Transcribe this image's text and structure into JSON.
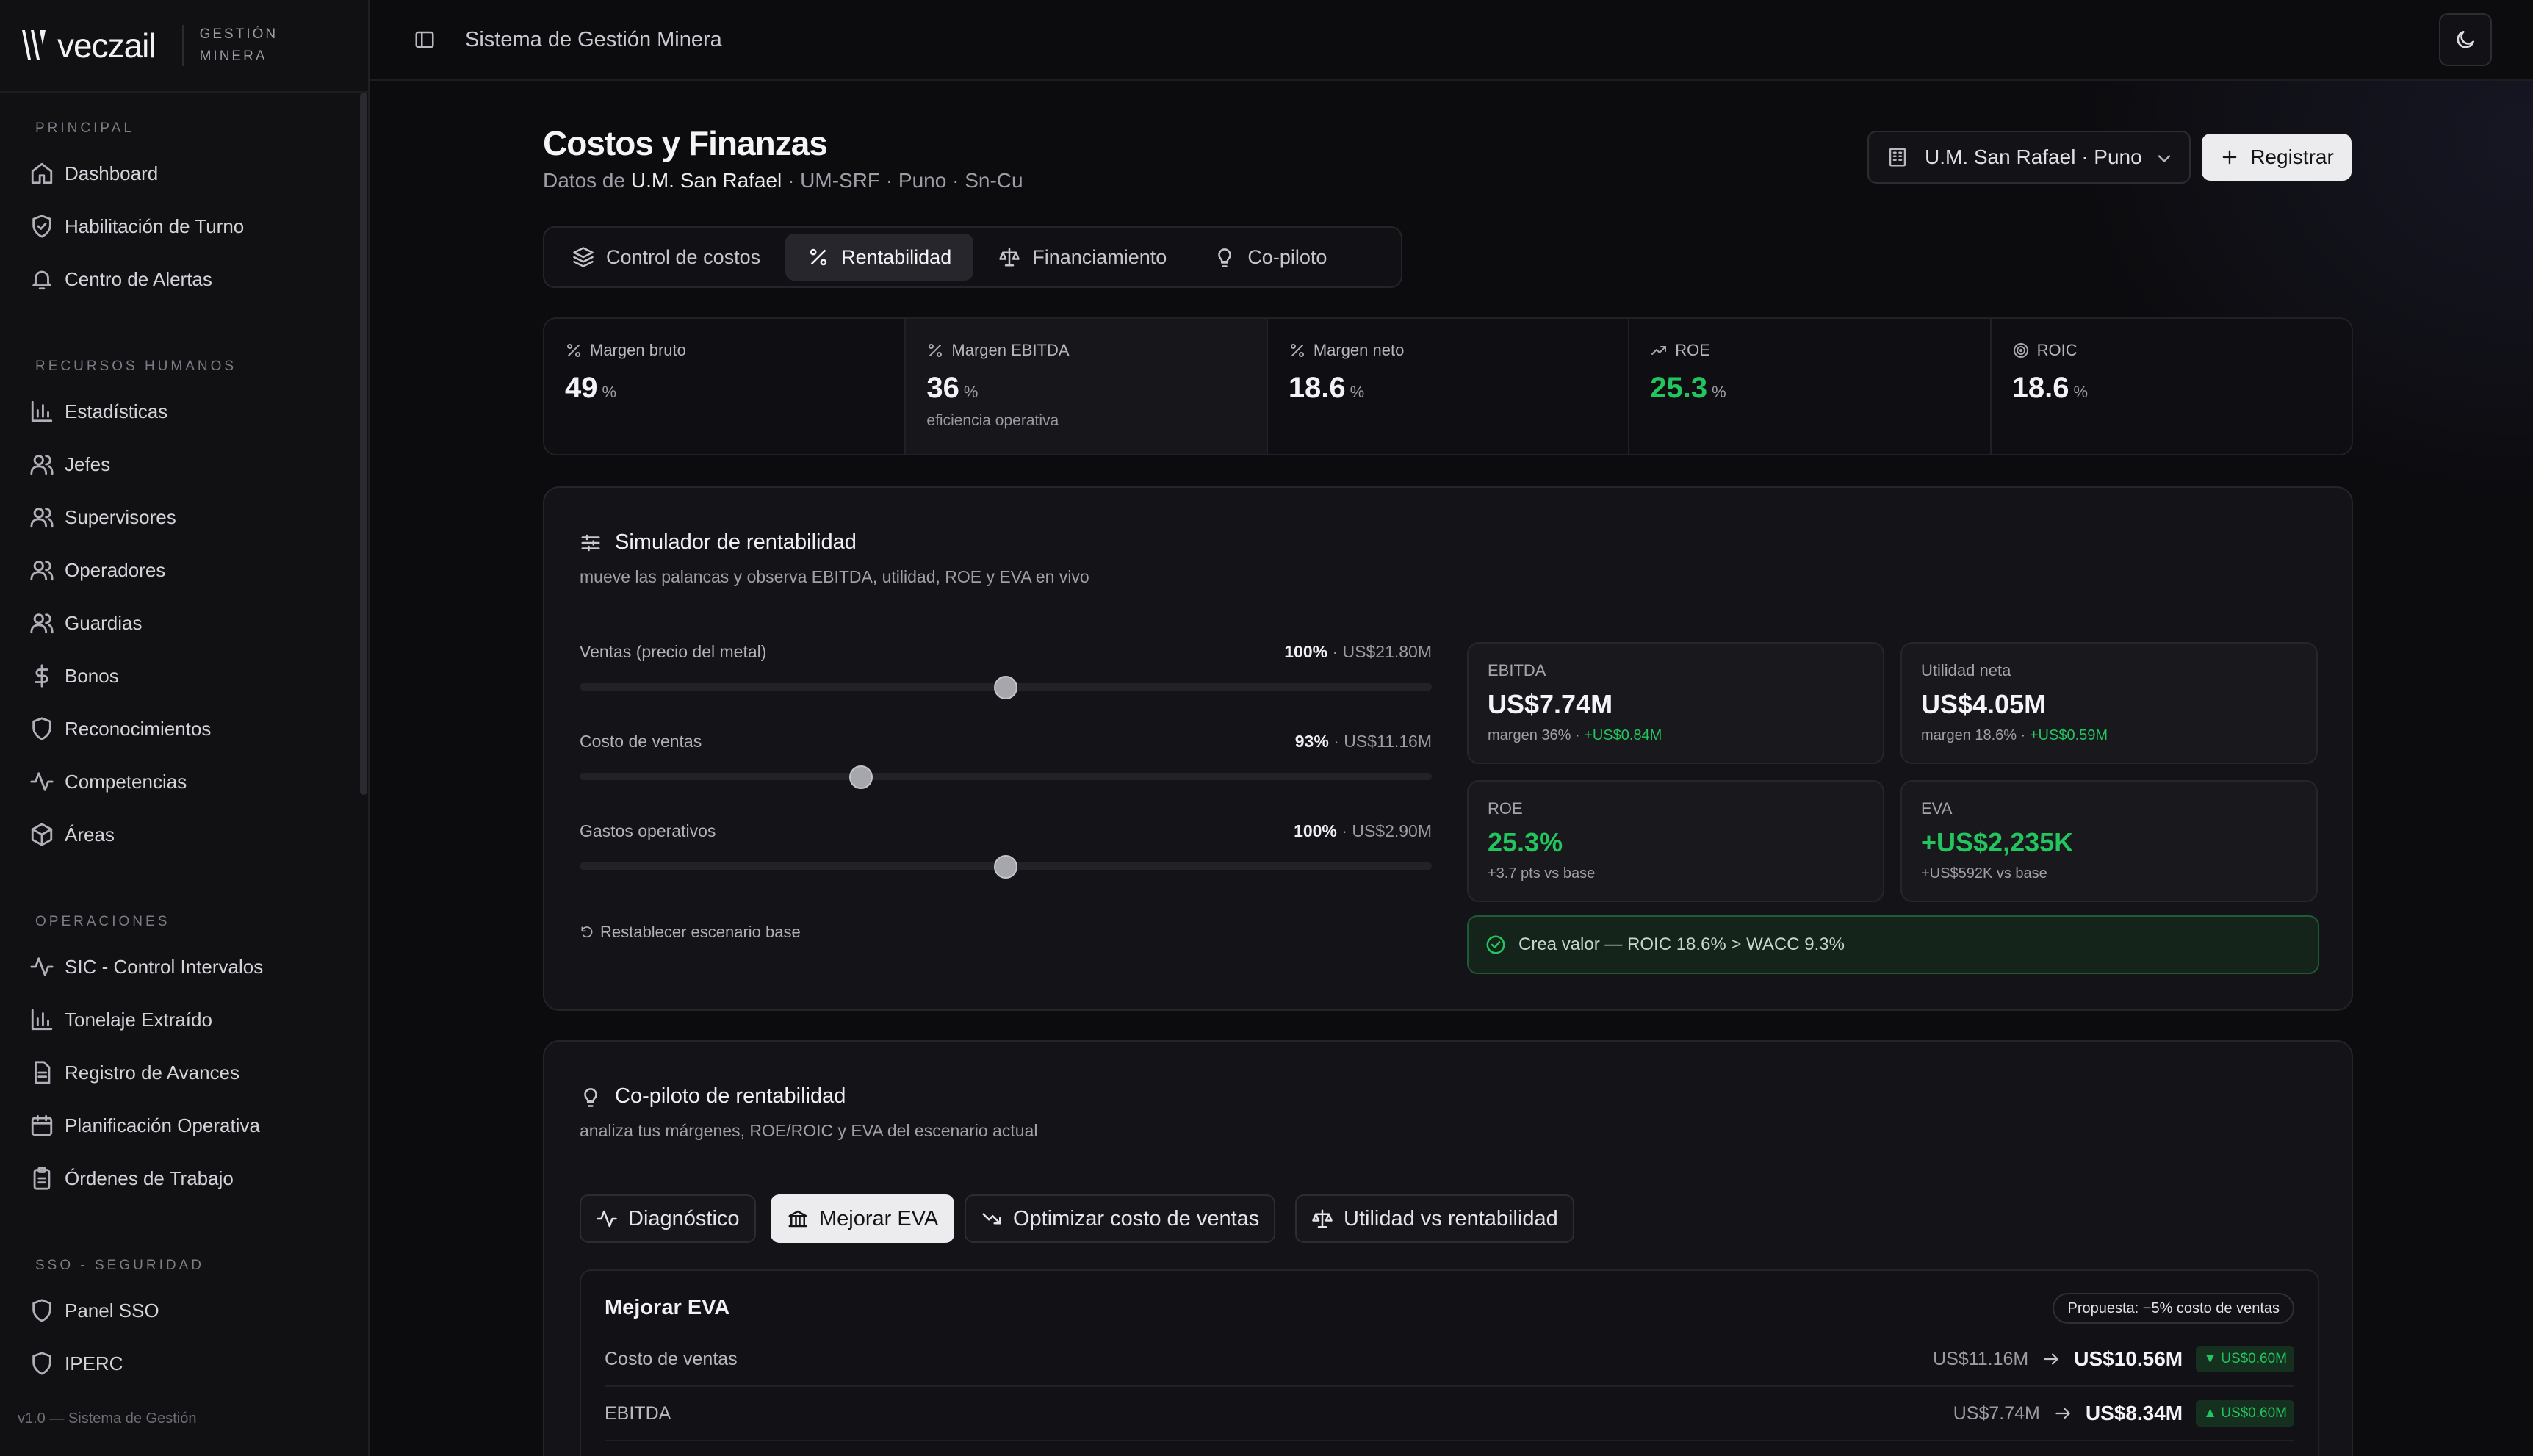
{
  "brand": {
    "name": "veczail",
    "sub_line1": "GESTIÓN",
    "sub_line2": "MINERA"
  },
  "topbar": {
    "title": "Sistema de Gestión Minera"
  },
  "sidebar": {
    "groups": [
      {
        "title": "PRINCIPAL",
        "items": [
          {
            "label": "Dashboard",
            "icon": "home-icon"
          },
          {
            "label": "Habilitación de Turno",
            "icon": "shield-check-icon"
          },
          {
            "label": "Centro de Alertas",
            "icon": "bell-icon"
          }
        ]
      },
      {
        "title": "RECURSOS HUMANOS",
        "items": [
          {
            "label": "Estadísticas",
            "icon": "bar-chart-icon"
          },
          {
            "label": "Jefes",
            "icon": "users-icon"
          },
          {
            "label": "Supervisores",
            "icon": "users-icon"
          },
          {
            "label": "Operadores",
            "icon": "users-icon"
          },
          {
            "label": "Guardias",
            "icon": "users-icon"
          },
          {
            "label": "Bonos",
            "icon": "dollar-icon"
          },
          {
            "label": "Reconocimientos",
            "icon": "shield-icon"
          },
          {
            "label": "Competencias",
            "icon": "activity-icon"
          },
          {
            "label": "Áreas",
            "icon": "box-icon"
          }
        ]
      },
      {
        "title": "OPERACIONES",
        "items": [
          {
            "label": "SIC - Control Intervalos",
            "icon": "activity-icon"
          },
          {
            "label": "Tonelaje Extraído",
            "icon": "bar-chart-icon"
          },
          {
            "label": "Registro de Avances",
            "icon": "file-icon"
          },
          {
            "label": "Planificación Operativa",
            "icon": "calendar-icon"
          },
          {
            "label": "Órdenes de Trabajo",
            "icon": "clipboard-icon"
          }
        ]
      },
      {
        "title": "SSO - SEGURIDAD",
        "items": [
          {
            "label": "Panel SSO",
            "icon": "shield-icon"
          },
          {
            "label": "IPERC",
            "icon": "shield-icon"
          }
        ]
      }
    ],
    "version": "v1.0 — Sistema de Gestión"
  },
  "page": {
    "title": "Costos y Finanzas",
    "sub_prefix": "Datos de",
    "unit_name": "U.M. San Rafael",
    "sub_suffix": "· UM-SRF · Puno · Sn-Cu",
    "mine_select": "U.M. San Rafael · Puno",
    "register_label": "Registrar"
  },
  "tabs": [
    {
      "label": "Control de costos",
      "icon": "layers-icon"
    },
    {
      "label": "Rentabilidad",
      "icon": "percent-icon"
    },
    {
      "label": "Financiamiento",
      "icon": "scale-icon"
    },
    {
      "label": "Co-piloto",
      "icon": "lightbulb-icon"
    }
  ],
  "kpis": [
    {
      "label": "Margen bruto",
      "value": "49",
      "unit": "%",
      "note": "",
      "icon": "percent-icon"
    },
    {
      "label": "Margen EBITDA",
      "value": "36",
      "unit": "%",
      "note": "eficiencia operativa",
      "icon": "percent-icon"
    },
    {
      "label": "Margen neto",
      "value": "18.6",
      "unit": "%",
      "note": "",
      "icon": "percent-icon"
    },
    {
      "label": "ROE",
      "value": "25.3",
      "unit": "%",
      "note": "",
      "icon": "trending-up-icon"
    },
    {
      "label": "ROIC",
      "value": "18.6",
      "unit": "%",
      "note": "",
      "icon": "target-icon"
    }
  ],
  "simulator": {
    "title": "Simulador de rentabilidad",
    "subtitle": "mueve las palancas y observa EBITDA, utilidad, ROE y EVA en vivo",
    "sliders": [
      {
        "label": "Ventas (precio del metal)",
        "percent": "100%",
        "amount": "· US$21.80M",
        "position": 0.5
      },
      {
        "label": "Costo de ventas",
        "percent": "93%",
        "amount": "· US$11.16M",
        "position": 0.33
      },
      {
        "label": "Gastos operativos",
        "percent": "100%",
        "amount": "· US$2.90M",
        "position": 0.5
      }
    ],
    "reset_label": "Restablecer escenario base",
    "cards": [
      {
        "label": "EBITDA",
        "value": "US$7.74M",
        "note": "margen 36% · ",
        "delta": "+US$0.84M",
        "green": false
      },
      {
        "label": "Utilidad neta",
        "value": "US$4.05M",
        "note": "margen 18.6% · ",
        "delta": "+US$0.59M",
        "green": false
      },
      {
        "label": "ROE",
        "value": "25.3%",
        "note": "+3.7 pts vs base",
        "delta": "",
        "green": true
      },
      {
        "label": "EVA",
        "value": "+US$2,235K",
        "note": "+US$592K vs base",
        "delta": "",
        "green": true
      }
    ],
    "banner": "Crea valor — ROIC 18.6% > WACC 9.3%"
  },
  "copilot": {
    "title": "Co-piloto de rentabilidad",
    "subtitle": "analiza tus márgenes, ROE/ROIC y EVA del escenario actual",
    "actions": [
      {
        "label": "Diagnóstico",
        "icon": "activity-icon"
      },
      {
        "label": "Mejorar EVA",
        "icon": "bank-icon"
      },
      {
        "label": "Optimizar costo de ventas",
        "icon": "trending-down-icon"
      },
      {
        "label": "Utilidad vs rentabilidad",
        "icon": "scale-icon"
      }
    ],
    "proposal": {
      "title": "Mejorar EVA",
      "badge": "Propuesta: −5% costo de ventas",
      "rows": [
        {
          "label": "Costo de ventas",
          "from": "US$11.16M",
          "to": "US$10.56M",
          "delta": "▼ US$0.60M"
        },
        {
          "label": "EBITDA",
          "from": "US$7.74M",
          "to": "US$8.34M",
          "delta": "▲ US$0.60M"
        }
      ]
    }
  },
  "colors": {
    "positive": "#22c55e",
    "background": "#0c0c0f",
    "panel": "#141418"
  }
}
